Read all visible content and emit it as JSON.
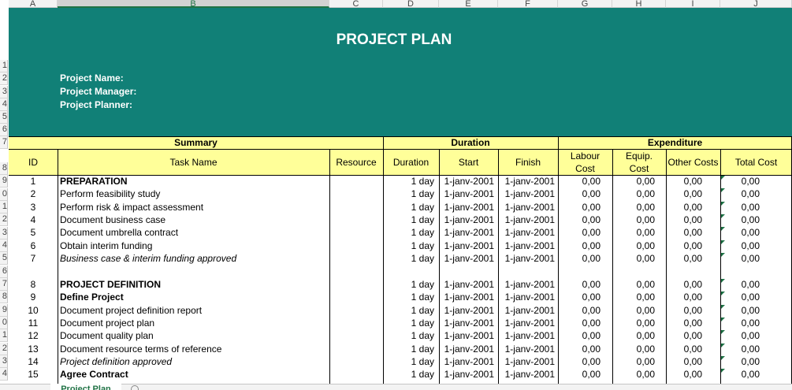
{
  "columns": [
    "A",
    "B",
    "C",
    "D",
    "E",
    "F",
    "G",
    "H",
    "I",
    "J"
  ],
  "row_numbers": [
    "1",
    "2",
    "3",
    "4",
    "5",
    "6",
    "7",
    "8",
    "9",
    "0",
    "1",
    "2",
    "3",
    "4",
    "5",
    "6",
    "7",
    "8",
    "9",
    "0",
    "1",
    "2",
    "3",
    "4"
  ],
  "title": "PROJECT PLAN",
  "meta": {
    "project_name": "Project Name:",
    "project_manager": "Project Manager:",
    "project_planner": "Project Planner:"
  },
  "groups": {
    "summary": "Summary",
    "duration": "Duration",
    "expenditure": "Expenditure"
  },
  "headers": {
    "id": "ID",
    "task_name": "Task Name",
    "resource": "Resource",
    "duration": "Duration",
    "start": "Start",
    "finish": "Finish",
    "labour1": "Labour",
    "labour2": "Cost",
    "equip1": "Equip.",
    "equip2": "Cost",
    "other": "Other Costs",
    "total": "Total Cost"
  },
  "rows": [
    {
      "id": "1",
      "task": "PREPARATION",
      "style": "bold",
      "duration": "1 day",
      "start": "1-janv-2001",
      "finish": "1-janv-2001",
      "labour": "0,00",
      "equip": "0,00",
      "other": "0,00",
      "total": "0,00"
    },
    {
      "id": "2",
      "task": "Perform feasibility study",
      "style": "",
      "duration": "1 day",
      "start": "1-janv-2001",
      "finish": "1-janv-2001",
      "labour": "0,00",
      "equip": "0,00",
      "other": "0,00",
      "total": "0,00"
    },
    {
      "id": "3",
      "task": "Perform risk & impact assessment",
      "style": "",
      "duration": "1 day",
      "start": "1-janv-2001",
      "finish": "1-janv-2001",
      "labour": "0,00",
      "equip": "0,00",
      "other": "0,00",
      "total": "0,00"
    },
    {
      "id": "4",
      "task": "Document business case",
      "style": "",
      "duration": "1 day",
      "start": "1-janv-2001",
      "finish": "1-janv-2001",
      "labour": "0,00",
      "equip": "0,00",
      "other": "0,00",
      "total": "0,00"
    },
    {
      "id": "5",
      "task": "Document umbrella contract",
      "style": "",
      "duration": "1 day",
      "start": "1-janv-2001",
      "finish": "1-janv-2001",
      "labour": "0,00",
      "equip": "0,00",
      "other": "0,00",
      "total": "0,00"
    },
    {
      "id": "6",
      "task": "Obtain interim funding",
      "style": "",
      "duration": "1 day",
      "start": "1-janv-2001",
      "finish": "1-janv-2001",
      "labour": "0,00",
      "equip": "0,00",
      "other": "0,00",
      "total": "0,00"
    },
    {
      "id": "7",
      "task": "Business case & interim funding approved",
      "style": "ital",
      "duration": "1 day",
      "start": "1-janv-2001",
      "finish": "1-janv-2001",
      "labour": "0,00",
      "equip": "0,00",
      "other": "0,00",
      "total": "0,00"
    },
    {
      "id": "",
      "task": "",
      "style": "",
      "duration": "",
      "start": "",
      "finish": "",
      "labour": "",
      "equip": "",
      "other": "",
      "total": ""
    },
    {
      "id": "8",
      "task": "PROJECT DEFINITION",
      "style": "bold",
      "duration": "1 day",
      "start": "1-janv-2001",
      "finish": "1-janv-2001",
      "labour": "0,00",
      "equip": "0,00",
      "other": "0,00",
      "total": "0,00"
    },
    {
      "id": "9",
      "task": "Define Project",
      "style": "bold",
      "duration": "1 day",
      "start": "1-janv-2001",
      "finish": "1-janv-2001",
      "labour": "0,00",
      "equip": "0,00",
      "other": "0,00",
      "total": "0,00"
    },
    {
      "id": "10",
      "task": "Document project definition report",
      "style": "",
      "duration": "1 day",
      "start": "1-janv-2001",
      "finish": "1-janv-2001",
      "labour": "0,00",
      "equip": "0,00",
      "other": "0,00",
      "total": "0,00"
    },
    {
      "id": "11",
      "task": "Document project plan",
      "style": "",
      "duration": "1 day",
      "start": "1-janv-2001",
      "finish": "1-janv-2001",
      "labour": "0,00",
      "equip": "0,00",
      "other": "0,00",
      "total": "0,00"
    },
    {
      "id": "12",
      "task": "Document quality plan",
      "style": "",
      "duration": "1 day",
      "start": "1-janv-2001",
      "finish": "1-janv-2001",
      "labour": "0,00",
      "equip": "0,00",
      "other": "0,00",
      "total": "0,00"
    },
    {
      "id": "13",
      "task": "Document resource terms of reference",
      "style": "",
      "duration": "1 day",
      "start": "1-janv-2001",
      "finish": "1-janv-2001",
      "labour": "0,00",
      "equip": "0,00",
      "other": "0,00",
      "total": "0,00"
    },
    {
      "id": "14",
      "task": "Project definition approved",
      "style": "ital",
      "duration": "1 day",
      "start": "1-janv-2001",
      "finish": "1-janv-2001",
      "labour": "0,00",
      "equip": "0,00",
      "other": "0,00",
      "total": "0,00"
    },
    {
      "id": "15",
      "task": "Agree Contract",
      "style": "bold",
      "duration": "1 day",
      "start": "1-janv-2001",
      "finish": "1-janv-2001",
      "labour": "0,00",
      "equip": "0,00",
      "other": "0,00",
      "total": "0,00"
    }
  ],
  "sheet_tab": "Project Plan"
}
